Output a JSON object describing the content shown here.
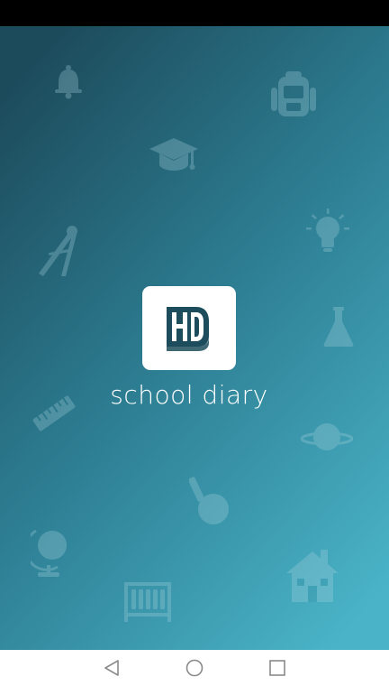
{
  "app": {
    "name": "school diary",
    "logo_icon": "diary-book-logo-icon"
  },
  "colors": {
    "gradient_top": "#1c4b5b",
    "gradient_mid": "#2e7f94",
    "gradient_bottom": "#4ab3c7",
    "logo_dark": "#1d4d5d",
    "icon_tint": "#a6d3de",
    "nav_icon": "#8a8a8a"
  },
  "background_icons": [
    "bell-icon",
    "backpack-icon",
    "graduation-cap-icon",
    "lightbulb-icon",
    "compass-icon",
    "flask-icon",
    "ruler-icon",
    "planet-icon",
    "round-flask-icon",
    "globe-icon",
    "abacus-icon",
    "school-house-icon"
  ],
  "nav_bar": {
    "buttons": [
      "back-icon",
      "home-icon",
      "recents-icon"
    ]
  }
}
